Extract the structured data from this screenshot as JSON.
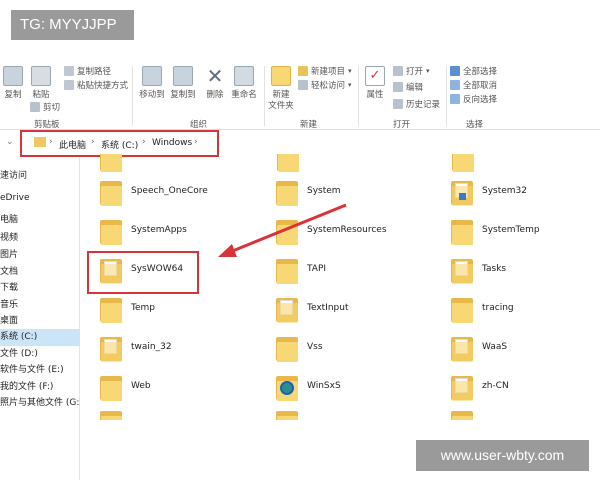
{
  "tag_badge": "TG: MYYJJPP",
  "watermark": "www.user-wbty.com",
  "ribbon": {
    "clipboard": {
      "copy": "复制",
      "paste": "粘贴",
      "copy_path": "复制路径",
      "paste_shortcut": "粘贴快捷方式",
      "cut": "剪切",
      "group_label": "剪贴板"
    },
    "organize": {
      "move_to": "移动到",
      "copy_to": "复制到",
      "delete": "删除",
      "rename": "重命名",
      "group_label": "组织"
    },
    "new": {
      "new_folder": "新建\n文件夹",
      "new_item": "新建项目",
      "easy_access": "轻松访问",
      "group_label": "新建"
    },
    "open": {
      "properties": "属性",
      "open": "打开",
      "edit": "编辑",
      "history": "历史记录",
      "group_label": "打开"
    },
    "select": {
      "select_all": "全部选择",
      "select_none": "全部取消",
      "invert": "反向选择",
      "group_label": "选择"
    }
  },
  "address": {
    "segments": [
      "此电脑",
      "系统 (C:)",
      "Windows"
    ]
  },
  "nav": {
    "items": [
      {
        "label": "速访问"
      },
      {
        "label": "eDrive"
      },
      {
        "label": "电脑"
      },
      {
        "label": "视频"
      },
      {
        "label": "图片"
      },
      {
        "label": "文档"
      },
      {
        "label": "下载"
      },
      {
        "label": "音乐"
      },
      {
        "label": "桌面"
      },
      {
        "label": "系统 (C:)"
      },
      {
        "label": "文件 (D:)"
      },
      {
        "label": "软件与文件 (E:)"
      },
      {
        "label": "我的文件 (F:)"
      },
      {
        "label": "照片与其他文件 (G:)"
      }
    ],
    "selected_index": 9
  },
  "files": {
    "col1": [
      {
        "name": "Speech_OneCore",
        "icon": "folder"
      },
      {
        "name": "SystemApps",
        "icon": "folder"
      },
      {
        "name": "SysWOW64",
        "icon": "folder-open"
      },
      {
        "name": "Temp",
        "icon": "folder"
      },
      {
        "name": "twain_32",
        "icon": "folder-doc"
      },
      {
        "name": "Web",
        "icon": "folder"
      }
    ],
    "col2": [
      {
        "name": "System",
        "icon": "folder"
      },
      {
        "name": "SystemResources",
        "icon": "folder"
      },
      {
        "name": "TAPI",
        "icon": "folder"
      },
      {
        "name": "TextInput",
        "icon": "folder-doc"
      },
      {
        "name": "Vss",
        "icon": "folder"
      },
      {
        "name": "WinSxS",
        "icon": "winsxs"
      }
    ],
    "col3": [
      {
        "name": "System32",
        "icon": "folder-blue"
      },
      {
        "name": "SystemTemp",
        "icon": "folder"
      },
      {
        "name": "Tasks",
        "icon": "folder-doc"
      },
      {
        "name": "tracing",
        "icon": "folder"
      },
      {
        "name": "WaaS",
        "icon": "folder-doc"
      },
      {
        "name": "zh-CN",
        "icon": "folder-doc"
      }
    ]
  },
  "colors": {
    "annotation": "#d9333a",
    "folder": "#f8d775",
    "folder_dark": "#e8b84a",
    "nav_selected": "#cce4f7"
  }
}
